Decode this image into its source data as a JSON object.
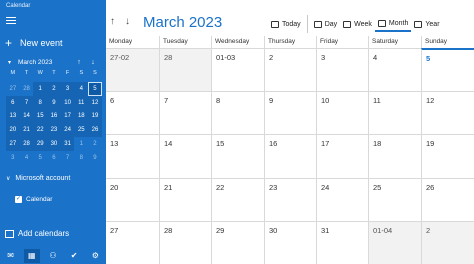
{
  "sidebar": {
    "app_title": "Calendar",
    "new_event_label": "New event",
    "mini_month": "March 2023",
    "weekdays": [
      "M",
      "T",
      "W",
      "T",
      "F",
      "S",
      "S"
    ],
    "days": [
      {
        "label": "27",
        "other": true
      },
      {
        "label": "28",
        "other": true
      },
      {
        "label": "1",
        "sel": true
      },
      {
        "label": "2",
        "sel": true
      },
      {
        "label": "3",
        "sel": true
      },
      {
        "label": "4",
        "sel": true
      },
      {
        "label": "5",
        "sel": true,
        "today": true
      },
      {
        "label": "6",
        "sel": true
      },
      {
        "label": "7",
        "sel": true
      },
      {
        "label": "8",
        "sel": true
      },
      {
        "label": "9",
        "sel": true
      },
      {
        "label": "10",
        "sel": true
      },
      {
        "label": "11",
        "sel": true
      },
      {
        "label": "12",
        "sel": true
      },
      {
        "label": "13",
        "sel": true
      },
      {
        "label": "14",
        "sel": true
      },
      {
        "label": "15",
        "sel": true
      },
      {
        "label": "16",
        "sel": true
      },
      {
        "label": "17",
        "sel": true
      },
      {
        "label": "18",
        "sel": true
      },
      {
        "label": "19",
        "sel": true
      },
      {
        "label": "20",
        "sel": true
      },
      {
        "label": "21",
        "sel": true
      },
      {
        "label": "22",
        "sel": true
      },
      {
        "label": "23",
        "sel": true
      },
      {
        "label": "24",
        "sel": true
      },
      {
        "label": "25",
        "sel": true
      },
      {
        "label": "26",
        "sel": true
      },
      {
        "label": "27",
        "sel": true
      },
      {
        "label": "28",
        "sel": true
      },
      {
        "label": "29",
        "sel": true
      },
      {
        "label": "30",
        "sel": true
      },
      {
        "label": "31",
        "sel": true
      },
      {
        "label": "1",
        "other": true
      },
      {
        "label": "2",
        "other": true
      },
      {
        "label": "3",
        "other": true
      },
      {
        "label": "4",
        "other": true
      },
      {
        "label": "5",
        "other": true
      },
      {
        "label": "6",
        "other": true
      },
      {
        "label": "7",
        "other": true
      },
      {
        "label": "8",
        "other": true
      },
      {
        "label": "9",
        "other": true
      }
    ],
    "account_label": "Microsoft account",
    "calendar_item_label": "Calendar",
    "add_calendars_label": "Add calendars",
    "bottom_icons": [
      "mail-icon",
      "calendar-icon",
      "people-icon",
      "todo-icon",
      "settings-icon"
    ]
  },
  "main": {
    "month_title": "March 2023",
    "toolbar": {
      "today": "Today",
      "day": "Day",
      "week": "Week",
      "month": "Month",
      "year": "Year"
    },
    "weekdays": [
      "Monday",
      "Tuesday",
      "Wednesday",
      "Thursday",
      "Friday",
      "Saturday",
      "Sunday"
    ],
    "cells": [
      {
        "label": "27-02",
        "gray": true
      },
      {
        "label": "28",
        "gray": true
      },
      {
        "label": "01-03"
      },
      {
        "label": "2"
      },
      {
        "label": "3"
      },
      {
        "label": "4"
      },
      {
        "label": "5",
        "today": true
      },
      {
        "label": "6"
      },
      {
        "label": "7"
      },
      {
        "label": "8"
      },
      {
        "label": "9"
      },
      {
        "label": "10"
      },
      {
        "label": "11"
      },
      {
        "label": "12"
      },
      {
        "label": "13"
      },
      {
        "label": "14"
      },
      {
        "label": "15"
      },
      {
        "label": "16"
      },
      {
        "label": "17"
      },
      {
        "label": "18"
      },
      {
        "label": "19"
      },
      {
        "label": "20"
      },
      {
        "label": "21"
      },
      {
        "label": "22"
      },
      {
        "label": "23"
      },
      {
        "label": "24"
      },
      {
        "label": "25"
      },
      {
        "label": "26"
      },
      {
        "label": "27"
      },
      {
        "label": "28"
      },
      {
        "label": "29"
      },
      {
        "label": "30"
      },
      {
        "label": "31"
      },
      {
        "label": "01-04",
        "gray": true
      },
      {
        "label": "2",
        "gray": true
      }
    ]
  },
  "colors": {
    "accent": "#1a72c9",
    "sidebar_bg": "#1a72c9",
    "grid_line": "#d9d9d9",
    "other_month_bg": "#f2f2f2"
  }
}
